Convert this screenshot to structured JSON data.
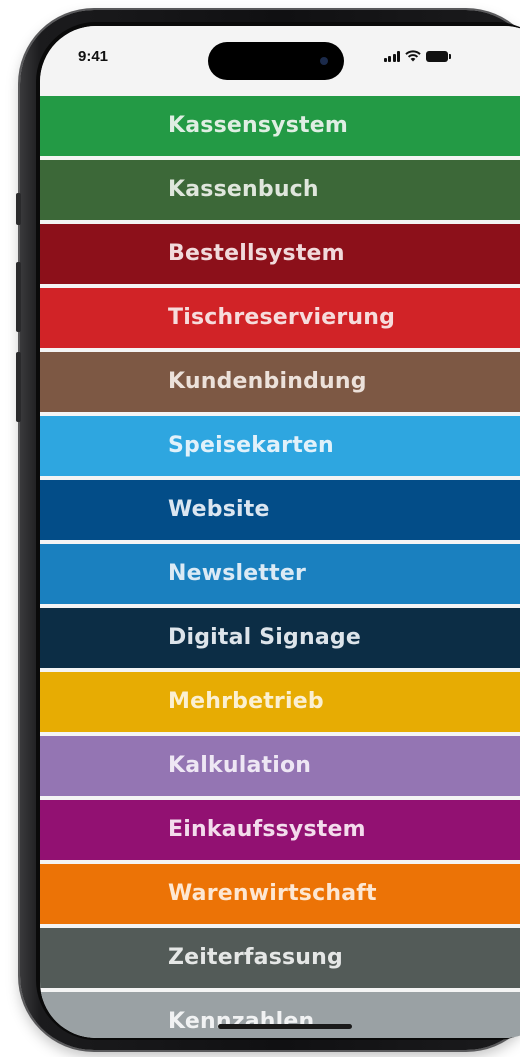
{
  "status_bar": {
    "time": "9:41",
    "icons": [
      "cellular-signal-icon",
      "wifi-icon",
      "battery-icon"
    ]
  },
  "menu": {
    "items": [
      {
        "label": "Kassensystem",
        "bg": "#239a45",
        "fg": "#dfeee3"
      },
      {
        "label": "Kassenbuch",
        "bg": "#3c6838",
        "fg": "#dfe6dc"
      },
      {
        "label": "Bestellsystem",
        "bg": "#8c101a",
        "fg": "#f1dadb"
      },
      {
        "label": "Tischreservierung",
        "bg": "#d12327",
        "fg": "#f6dcdc"
      },
      {
        "label": "Kundenbindung",
        "bg": "#7d5844",
        "fg": "#ece1da"
      },
      {
        "label": "Speisekarten",
        "bg": "#2ea6e0",
        "fg": "#e1f1fa"
      },
      {
        "label": "Website",
        "bg": "#034d88",
        "fg": "#dbe6f1"
      },
      {
        "label": "Newsletter",
        "bg": "#1a80bf",
        "fg": "#dbeaf5"
      },
      {
        "label": "Digital Signage",
        "bg": "#0c2d45",
        "fg": "#dde4ea"
      },
      {
        "label": "Mehrbetrieb",
        "bg": "#e7ac03",
        "fg": "#fbf0d2"
      },
      {
        "label": "Kalkulation",
        "bg": "#9475b3",
        "fg": "#eee7f4"
      },
      {
        "label": "Einkaufssystem",
        "bg": "#921172",
        "fg": "#f3dcec"
      },
      {
        "label": "Warenwirtschaft",
        "bg": "#ec7306",
        "fg": "#fde7d3"
      },
      {
        "label": "Zeiterfassung",
        "bg": "#535b58",
        "fg": "#e5e7e6"
      },
      {
        "label": "Kennzahlen",
        "bg": "#9aa1a4",
        "fg": "#f1f2f3"
      }
    ]
  }
}
